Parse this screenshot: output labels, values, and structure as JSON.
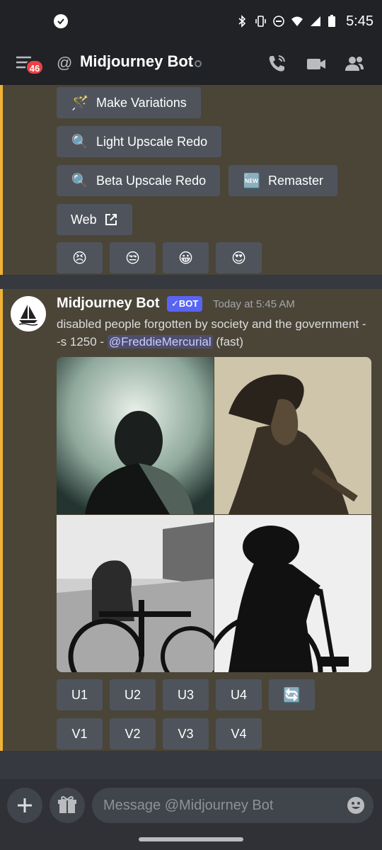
{
  "status_bar": {
    "time": "5:45",
    "icons": [
      "check-circle-icon",
      "bluetooth-icon",
      "vibrate-icon",
      "do-not-disturb-icon",
      "wifi-icon",
      "signal-icon",
      "battery-icon"
    ]
  },
  "header": {
    "badge_count": "46",
    "at_symbol": "@",
    "title": "Midjourney Bot",
    "icons": [
      "menu-icon",
      "phone-icon",
      "video-icon",
      "members-icon"
    ]
  },
  "previous_buttons": {
    "make_variations": {
      "emoji": "🪄",
      "label": "Make Variations"
    },
    "light_upscale_redo": {
      "emoji": "🔍",
      "label": "Light Upscale Redo"
    },
    "beta_upscale_redo": {
      "emoji": "🔍",
      "label": "Beta Upscale Redo"
    },
    "remaster": {
      "emoji": "🆕",
      "label": "Remaster"
    },
    "web": {
      "label": "Web",
      "icon": "external-link-icon"
    },
    "reactions": [
      "😣",
      "😒",
      "😀",
      "😍"
    ]
  },
  "message": {
    "author": "Midjourney Bot",
    "bot_tag": "✓BOT",
    "timestamp": "Today at 5:45 AM",
    "text_before": "disabled people forgotten by society and the government  --s 1250 - ",
    "mention": "@FreddieMercurial",
    "text_after": " (fast)"
  },
  "actions": {
    "upscale": [
      "U1",
      "U2",
      "U3",
      "U4"
    ],
    "refresh_emoji": "🔄",
    "variation": [
      "V1",
      "V2",
      "V3",
      "V4"
    ]
  },
  "composer": {
    "placeholder": "Message @Midjourney Bot",
    "icons": [
      "plus-icon",
      "gift-icon",
      "emoji-icon"
    ]
  },
  "colors": {
    "accent": "#f0b232",
    "mention_bg": "#5865f2",
    "button_bg": "#4f545c",
    "badge_red": "#ed4245"
  }
}
